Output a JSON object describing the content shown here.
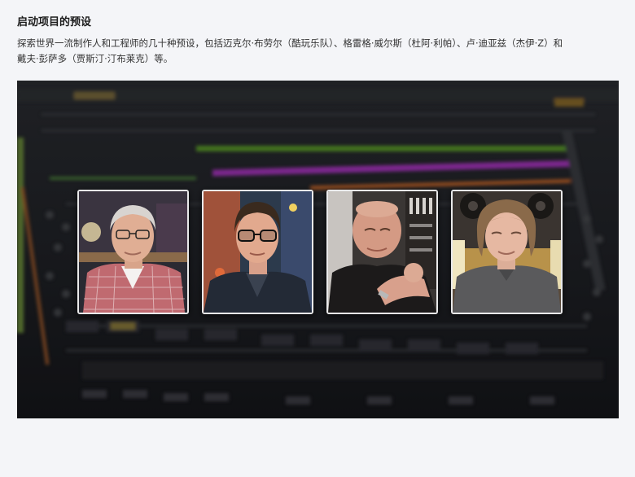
{
  "section": {
    "title": "启动项目的预设",
    "description": "探索世界一流制作人和工程师的几十种预设，包括迈克尔·布劳尔（酷玩乐队）、格雷格·威尔斯（杜阿·利帕）、卢·迪亚兹（杰伊·Z）和戴夫·彭萨多（贾斯汀·汀布莱克）等。"
  },
  "colors": {
    "page_bg": "#f4f5f8",
    "hero_bg": "#1b1d21",
    "accent_magenta": "#b03cc8",
    "accent_green": "#6fc030",
    "accent_orange": "#e07a2a",
    "card_border": "#e9e9ea"
  },
  "portraits": [
    {
      "icon": "portrait-producer-1"
    },
    {
      "icon": "portrait-producer-2"
    },
    {
      "icon": "portrait-producer-3"
    },
    {
      "icon": "portrait-producer-4"
    }
  ]
}
